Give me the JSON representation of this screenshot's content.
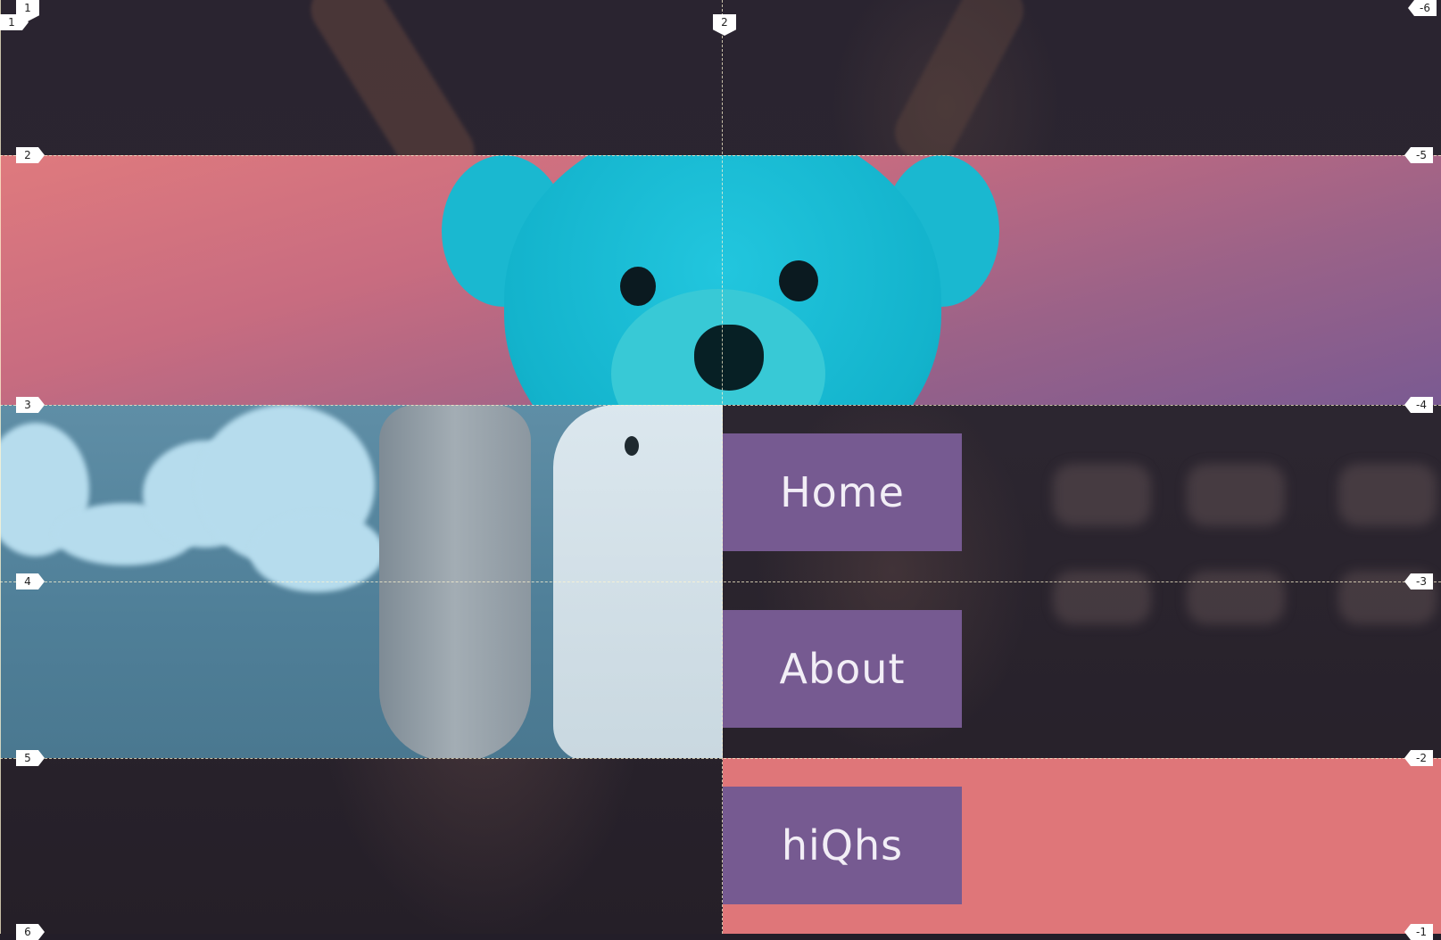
{
  "nav": {
    "items": [
      {
        "label": "Home"
      },
      {
        "label": "About"
      },
      {
        "label": "hiQhs"
      }
    ]
  },
  "guides": {
    "top_markers": [
      "1",
      "2",
      "-6"
    ],
    "left_markers": [
      "1",
      "2",
      "3",
      "4",
      "5",
      "6"
    ],
    "right_markers": [
      "-5",
      "-4",
      "-3",
      "-2",
      "-1"
    ],
    "corner_marker": "1"
  },
  "colors": {
    "nav_button": "#765a91",
    "coral": "#df7679",
    "teddy": "#17c0d8",
    "background": "#231e29"
  },
  "icons": [
    "teddy-bear-image",
    "skull-image"
  ]
}
